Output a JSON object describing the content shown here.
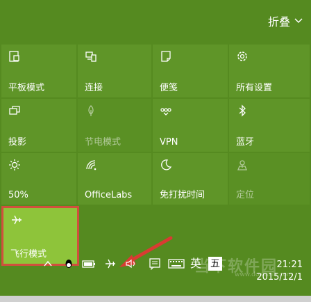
{
  "header": {
    "collapse_label": "折叠"
  },
  "tiles": [
    {
      "label": "平板模式",
      "icon": "tablet-mode-icon"
    },
    {
      "label": "连接",
      "icon": "connect-icon"
    },
    {
      "label": "便笺",
      "icon": "note-icon"
    },
    {
      "label": "所有设置",
      "icon": "settings-icon"
    },
    {
      "label": "投影",
      "icon": "project-icon"
    },
    {
      "label": "节电模式",
      "icon": "battery-saver-icon"
    },
    {
      "label": "VPN",
      "icon": "vpn-icon"
    },
    {
      "label": "蓝牙",
      "icon": "bluetooth-icon"
    },
    {
      "label": "50%",
      "icon": "brightness-icon"
    },
    {
      "label": "OfficeLabs",
      "icon": "wifi-icon"
    },
    {
      "label": "免打扰时间",
      "icon": "quiet-hours-icon"
    },
    {
      "label": "定位",
      "icon": "location-icon"
    },
    {
      "label": "飞行模式",
      "icon": "airplane-icon"
    }
  ],
  "taskbar": {
    "input_label": "英",
    "ime_label": "五",
    "time": "21:21",
    "date": "2015/12/1"
  },
  "watermark": {
    "text": "当下软件园",
    "url": "www.downxia.com"
  },
  "colors": {
    "background": "#558a20",
    "tile": "#5f9528",
    "active_tile": "#8ec43a",
    "highlight": "#d14f3d"
  }
}
